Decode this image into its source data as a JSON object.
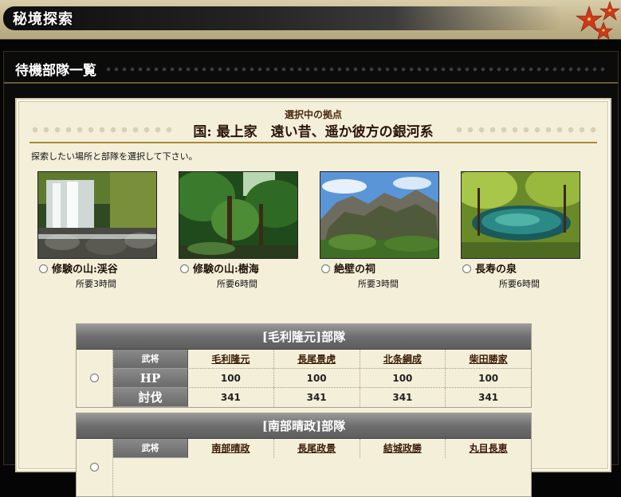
{
  "page": {
    "title": "秘境探索"
  },
  "section": {
    "title": "待機部隊一覧"
  },
  "selection": {
    "label": "選択中の拠点",
    "name": "国: 最上家　遠い昔、遥か彼方の銀河系"
  },
  "instruction": "探索したい場所と部隊を選択して下さい。",
  "spots": [
    {
      "name": "修験の山:渓谷",
      "time": "所要3時間",
      "scene": "waterfall"
    },
    {
      "name": "修験の山:樹海",
      "time": "所要6時間",
      "scene": "forest"
    },
    {
      "name": "絶壁の祠",
      "time": "所要3時間",
      "scene": "cliff"
    },
    {
      "name": "長寿の泉",
      "time": "所要6時間",
      "scene": "spring"
    }
  ],
  "squads": [
    {
      "title": "[毛利隆元]部隊",
      "row_labels": {
        "general": "武将",
        "hp": "HP",
        "attack": "討伐"
      },
      "generals": [
        "毛利隆元",
        "長尾景虎",
        "北条綱成",
        "柴田勝家"
      ],
      "hp": [
        "100",
        "100",
        "100",
        "100"
      ],
      "attack": [
        "341",
        "341",
        "341",
        "341"
      ]
    },
    {
      "title": "[南部晴政]部隊",
      "row_labels": {
        "general": "武将"
      },
      "generals": [
        "南部晴政",
        "長尾政景",
        "結城政勝",
        "丸目長恵"
      ]
    }
  ],
  "colors": {
    "accent": "#a98a38",
    "panel_bg": "#f4efd9",
    "header_gray": "#6e6e6e"
  }
}
